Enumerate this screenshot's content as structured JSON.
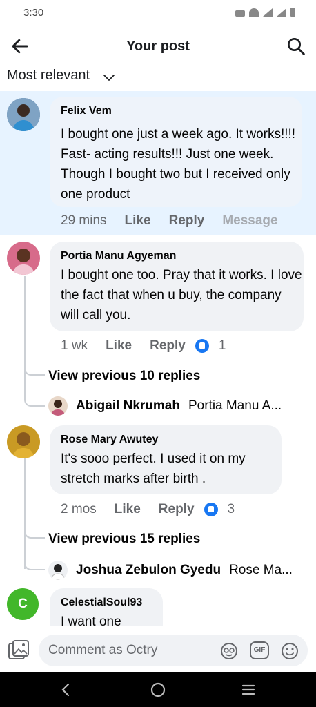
{
  "status_bar": {
    "time": "3:30"
  },
  "header": {
    "title": "Your post"
  },
  "sort": {
    "label": "Most relevant"
  },
  "comments": [
    {
      "name": "Felix Vem",
      "text": "I bought one just a week ago. It works!!!! Fast- acting results!!! Just one week. Though I bought two but I received only one product",
      "time": "29 mins",
      "like": "Like",
      "reply": "Reply",
      "message": "Message"
    },
    {
      "name": "Portia Manu Agyeman",
      "text": "I bought one too. Pray that it works. I love the fact that when u buy, the company will call you.",
      "time": "1 wk",
      "like": "Like",
      "reply": "Reply",
      "reactions": "1",
      "view_previous": "View previous 10 replies",
      "latest_reply": {
        "name": "Abigail Nkrumah",
        "text": "Portia Manu A..."
      }
    },
    {
      "name": "Rose Mary Awutey",
      "text": "It's sooo perfect. I used it on my stretch marks after birth .",
      "time": "2 mos",
      "like": "Like",
      "reply": "Reply",
      "reactions": "3",
      "view_previous": "View previous 15 replies",
      "latest_reply": {
        "name": "Joshua Zebulon Gyedu",
        "text": "Rose Ma..."
      }
    },
    {
      "name": "CelestialSoul93",
      "text": "I want one",
      "avatar_letter": "C"
    }
  ],
  "composer": {
    "placeholder": "Comment as Octry",
    "gif": "GIF"
  },
  "colors": {
    "accent": "#1877f2",
    "highlight": "#e7f3ff",
    "bubble": "#f0f2f5",
    "avatar_green": "#42b72a"
  }
}
